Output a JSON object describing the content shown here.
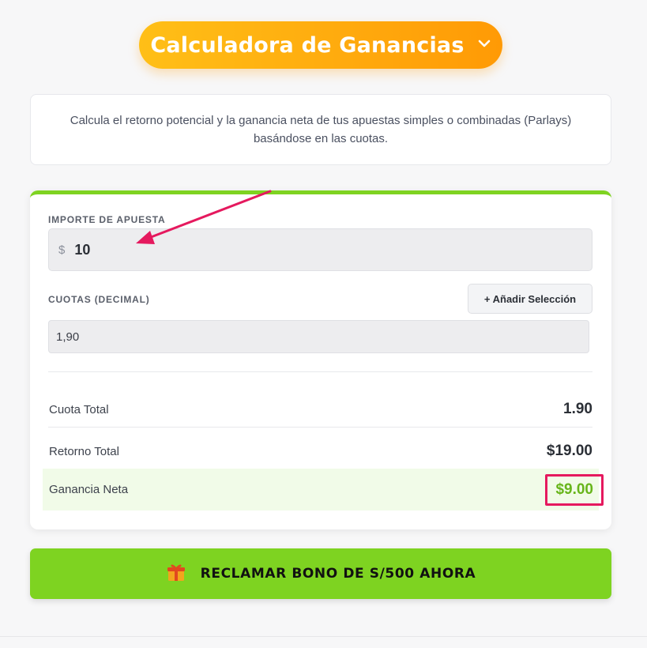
{
  "header": {
    "title": "Calculadora de Ganancias",
    "toggle_icon": "chevron-down-icon"
  },
  "description": "Calcula el retorno potencial y la ganancia neta de tus apuestas simples o combinadas (Parlays) basándose en las cuotas.",
  "calculator": {
    "stake_label": "IMPORTE DE APUESTA",
    "currency_symbol": "$",
    "stake_value": "10",
    "odds_label": "CUOTAS (DECIMAL)",
    "add_selection_label": "+ Añadir Selección",
    "odds_value": "1,90",
    "results": [
      {
        "label": "Cuota Total",
        "value": "1.90"
      },
      {
        "label": "Retorno Total",
        "value": "$19.00"
      },
      {
        "label": "Ganancia Neta",
        "value": "$9.00"
      }
    ]
  },
  "cta": {
    "icon": "gift-icon",
    "label": "RECLAMAR BONO DE S/500 AHORA"
  },
  "colors": {
    "title_gradient_start": "#ffbf17",
    "title_gradient_end": "#ff9a05",
    "accent_green": "#7ed321",
    "net_profit_green": "#67b51a",
    "annotation_pink": "#e5195e"
  }
}
